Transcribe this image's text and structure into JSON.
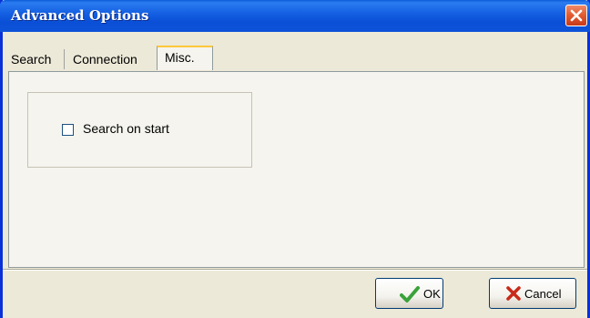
{
  "window": {
    "title": "Advanced Options"
  },
  "tabs": [
    {
      "label": "Search",
      "selected": false
    },
    {
      "label": "Connection",
      "selected": false
    },
    {
      "label": "Misc.",
      "selected": true
    }
  ],
  "misc": {
    "search_on_start": {
      "label": "Search on start",
      "checked": false
    }
  },
  "buttons": {
    "ok": {
      "label": "OK",
      "icon": "checkmark-icon"
    },
    "cancel": {
      "label": "Cancel",
      "icon": "x-icon"
    }
  },
  "colors": {
    "titlebar": "#0a4fd6",
    "close": "#e25a2e",
    "dialog_bg": "#ece9d8",
    "tab_highlight": "#ffc83c",
    "ok_check": "#3aa23a",
    "cancel_x": "#c82a1a"
  }
}
